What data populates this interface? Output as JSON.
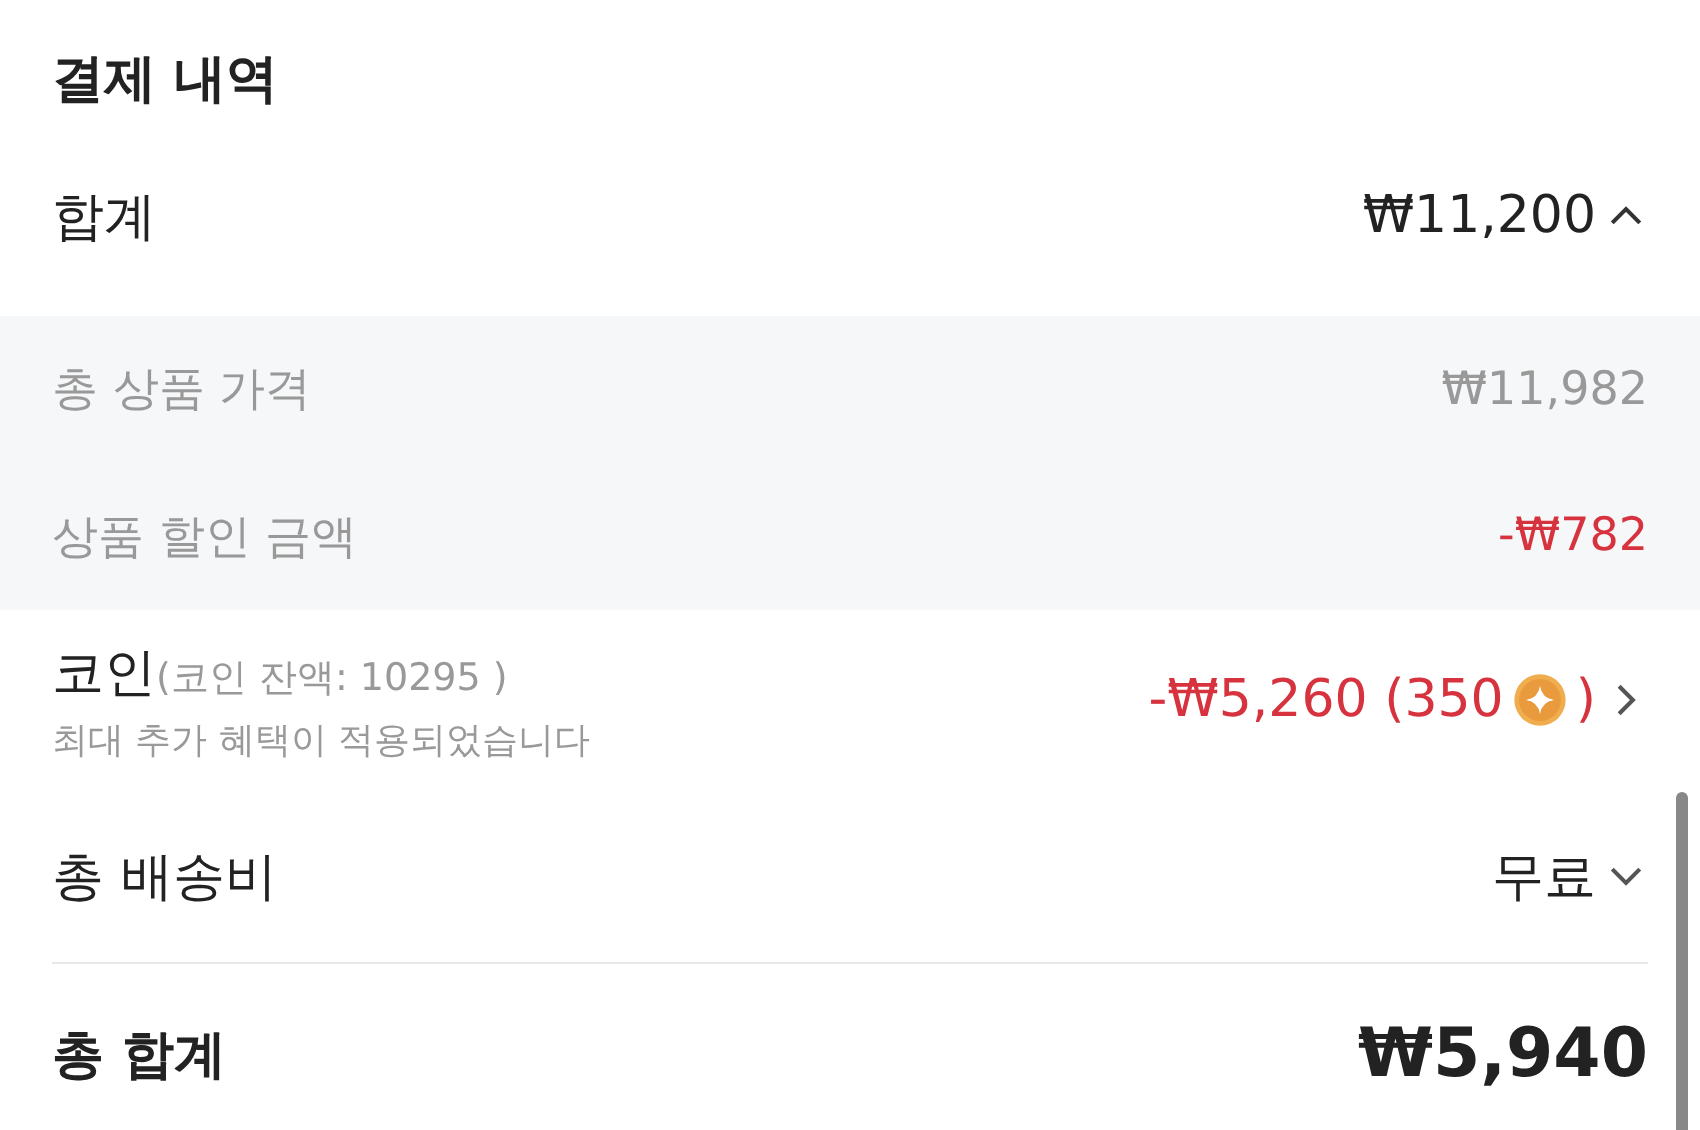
{
  "section_title": "결제 내역",
  "subtotal": {
    "label": "합계",
    "value": "₩11,200",
    "expanded": true
  },
  "breakdown": [
    {
      "label": "총 상품 가격",
      "value": "₩11,982",
      "kind": "normal"
    },
    {
      "label": "상품 할인 금액",
      "value": "-₩782",
      "kind": "discount"
    }
  ],
  "coin": {
    "label": "코인",
    "balance": "(코인 잔액: 10295 )",
    "note": "최대 추가 혜택이 적용되었습니다",
    "amount": "-₩5,260 (350",
    "amount_end": ")"
  },
  "shipping": {
    "label": "총 배송비",
    "value": "무료",
    "expanded": false
  },
  "total": {
    "label": "총 합계",
    "value": "₩5,940"
  }
}
